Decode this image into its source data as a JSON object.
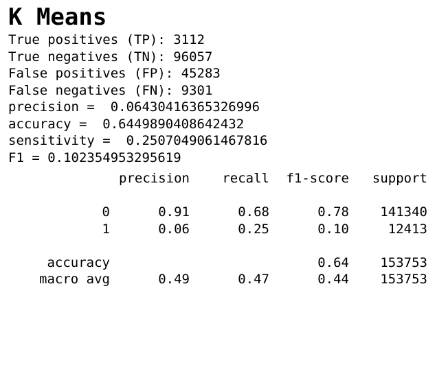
{
  "title": "K Means",
  "metrics": [
    "True positives (TP): 3112",
    "True negatives (TN): 96057",
    "False positives (FP): 45283",
    "False negatives (FN): 9301",
    "precision =  0.06430416365326996",
    "accuracy =  0.6449890408642432",
    "sensitivity =  0.2507049061467816",
    "F1 = 0.102354953295619"
  ],
  "report": {
    "headers": [
      "precision",
      "recall",
      "f1-score",
      "support"
    ],
    "rows": [
      {
        "label": "0",
        "precision": "0.91",
        "recall": "0.68",
        "f1": "0.78",
        "support": "141340"
      },
      {
        "label": "1",
        "precision": "0.06",
        "recall": "0.25",
        "f1": "0.10",
        "support": "12413"
      }
    ],
    "summary": [
      {
        "label": "accuracy",
        "precision": "",
        "recall": "",
        "f1": "0.64",
        "support": "153753"
      },
      {
        "label": "macro avg",
        "precision": "0.49",
        "recall": "0.47",
        "f1": "0.44",
        "support": "153753"
      }
    ]
  }
}
